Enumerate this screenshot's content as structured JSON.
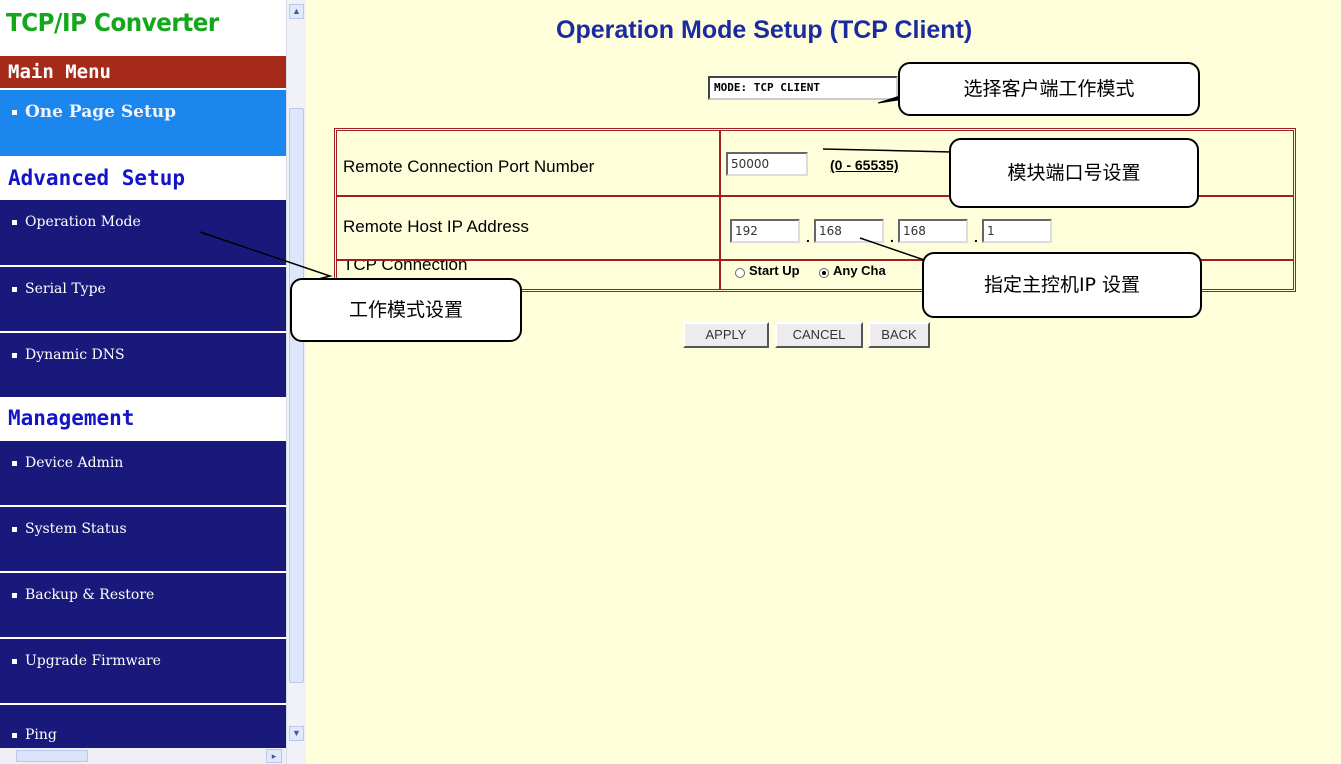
{
  "sidebar": {
    "title": "TCP/IP Converter",
    "main_menu": "Main Menu",
    "one_page_setup": "One Page Setup",
    "advanced_setup": "Advanced Setup",
    "operation_mode": "Operation Mode",
    "serial_type": "Serial Type",
    "dynamic_dns": "Dynamic DNS",
    "management": "Management",
    "device_admin": "Device Admin",
    "system_status": "System Status",
    "backup_restore": "Backup & Restore",
    "upgrade_firmware": "Upgrade Firmware",
    "ping": "Ping"
  },
  "page": {
    "title": "Operation Mode Setup (TCP Client)",
    "mode_value": "MODE: TCP CLIENT"
  },
  "form": {
    "port_label": "Remote Connection Port Number",
    "port_value": "50000",
    "port_range": "(0 - 65535)",
    "ip_label": "Remote Host IP Address",
    "ip_parts": [
      "192",
      "168",
      "168",
      "1"
    ],
    "ip_separator": ".",
    "tcp_label": "TCP Connection",
    "radio_startup": "Start Up",
    "radio_any": "Any Cha"
  },
  "buttons": {
    "apply": "APPLY",
    "cancel": "CANCEL",
    "back": "BACK"
  },
  "callouts": {
    "mode": "选择客户端工作模式",
    "port": "模块端口号设置",
    "host": "指定主控机IP 设置",
    "operation": "工作模式设置"
  },
  "colors": {
    "main_bg": "#fffedb",
    "title_green": "#13a81a",
    "menu_red": "#a52a1a",
    "nav_blue": "#1a86ee",
    "nav_dark": "#19197b",
    "section_blue": "#1414c8",
    "table_border": "#9e2020"
  },
  "icons": {
    "scroll_up": "chevron-up-icon",
    "scroll_down": "chevron-down-icon",
    "scroll_right": "chevron-right-icon"
  }
}
